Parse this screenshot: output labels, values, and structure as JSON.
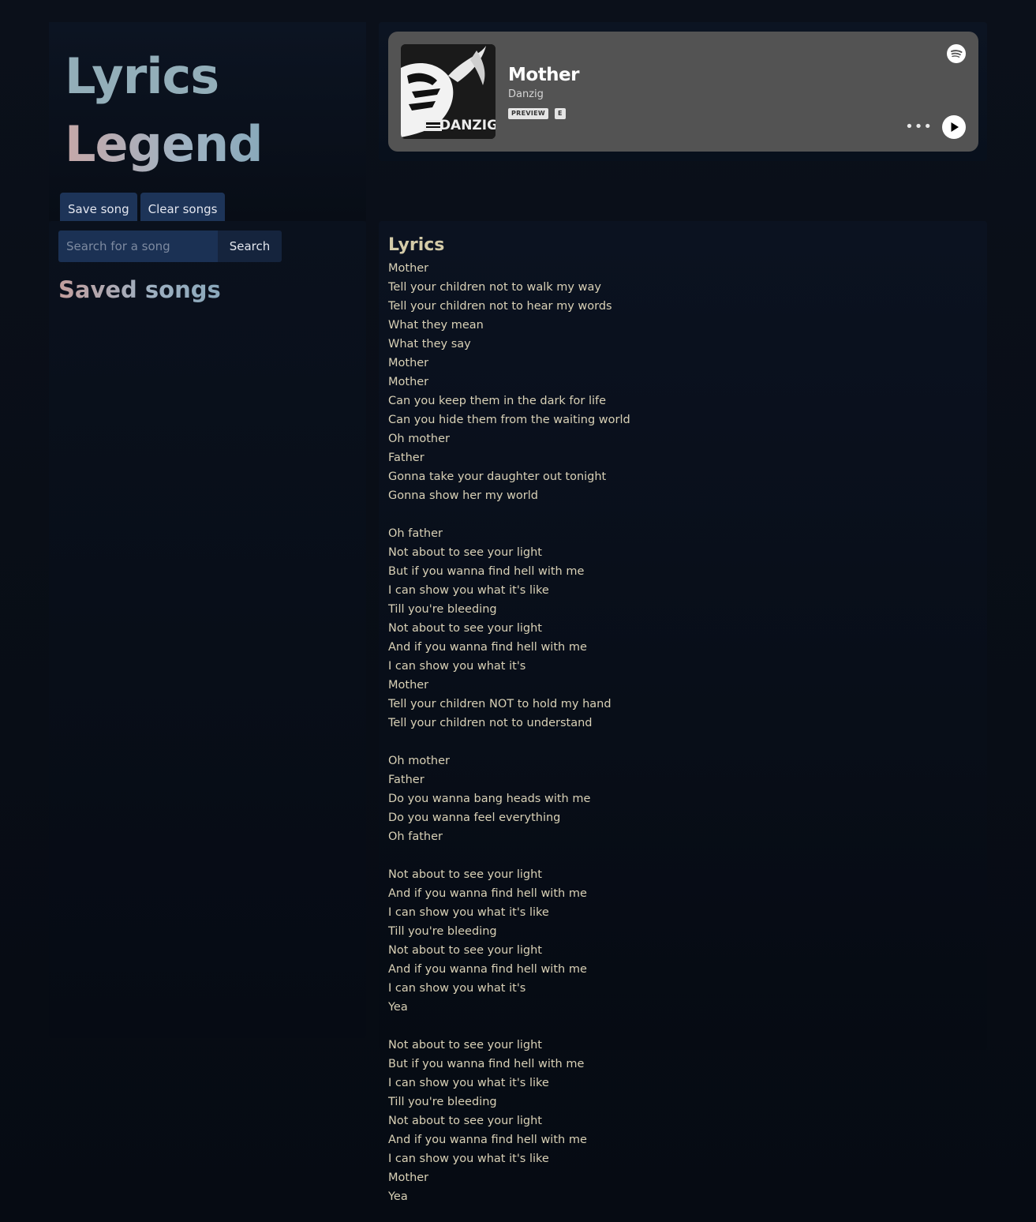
{
  "app": {
    "title_line1": "Lyrics",
    "title_line2": "Legend"
  },
  "toolbar": {
    "save_label": "Save song",
    "clear_label": "Clear songs"
  },
  "search": {
    "placeholder": "Search for a song",
    "button_label": "Search"
  },
  "sidebar": {
    "saved_heading": "Saved songs"
  },
  "player": {
    "track_title": "Mother",
    "artist": "Danzig",
    "preview_badge": "PREVIEW",
    "explicit_badge": "E",
    "cover_text": "DANZIG",
    "icons": [
      "spotify-icon",
      "more-icon",
      "play-icon"
    ]
  },
  "lyrics": {
    "heading": "Lyrics",
    "text": "Mother\nTell your children not to walk my way\nTell your children not to hear my words\nWhat they mean\nWhat they say\nMother\nMother\nCan you keep them in the dark for life\nCan you hide them from the waiting world\nOh mother\nFather\nGonna take your daughter out tonight\nGonna show her my world\n\nOh father\nNot about to see your light\nBut if you wanna find hell with me\nI can show you what it's like\nTill you're bleeding\nNot about to see your light\nAnd if you wanna find hell with me\nI can show you what it's\nMother\nTell your children NOT to hold my hand\nTell your children not to understand\n\nOh mother\nFather\nDo you wanna bang heads with me\nDo you wanna feel everything\nOh father\n\nNot about to see your light\nAnd if you wanna find hell with me\nI can show you what it's like\nTill you're bleeding\nNot about to see your light\nAnd if you wanna find hell with me\nI can show you what it's\nYea\n\nNot about to see your light\nBut if you wanna find hell with me\nI can show you what it's like\nTill you're bleeding\nNot about to see your light\nAnd if you wanna find hell with me\nI can show you what it's like\nMother\nYea"
  }
}
